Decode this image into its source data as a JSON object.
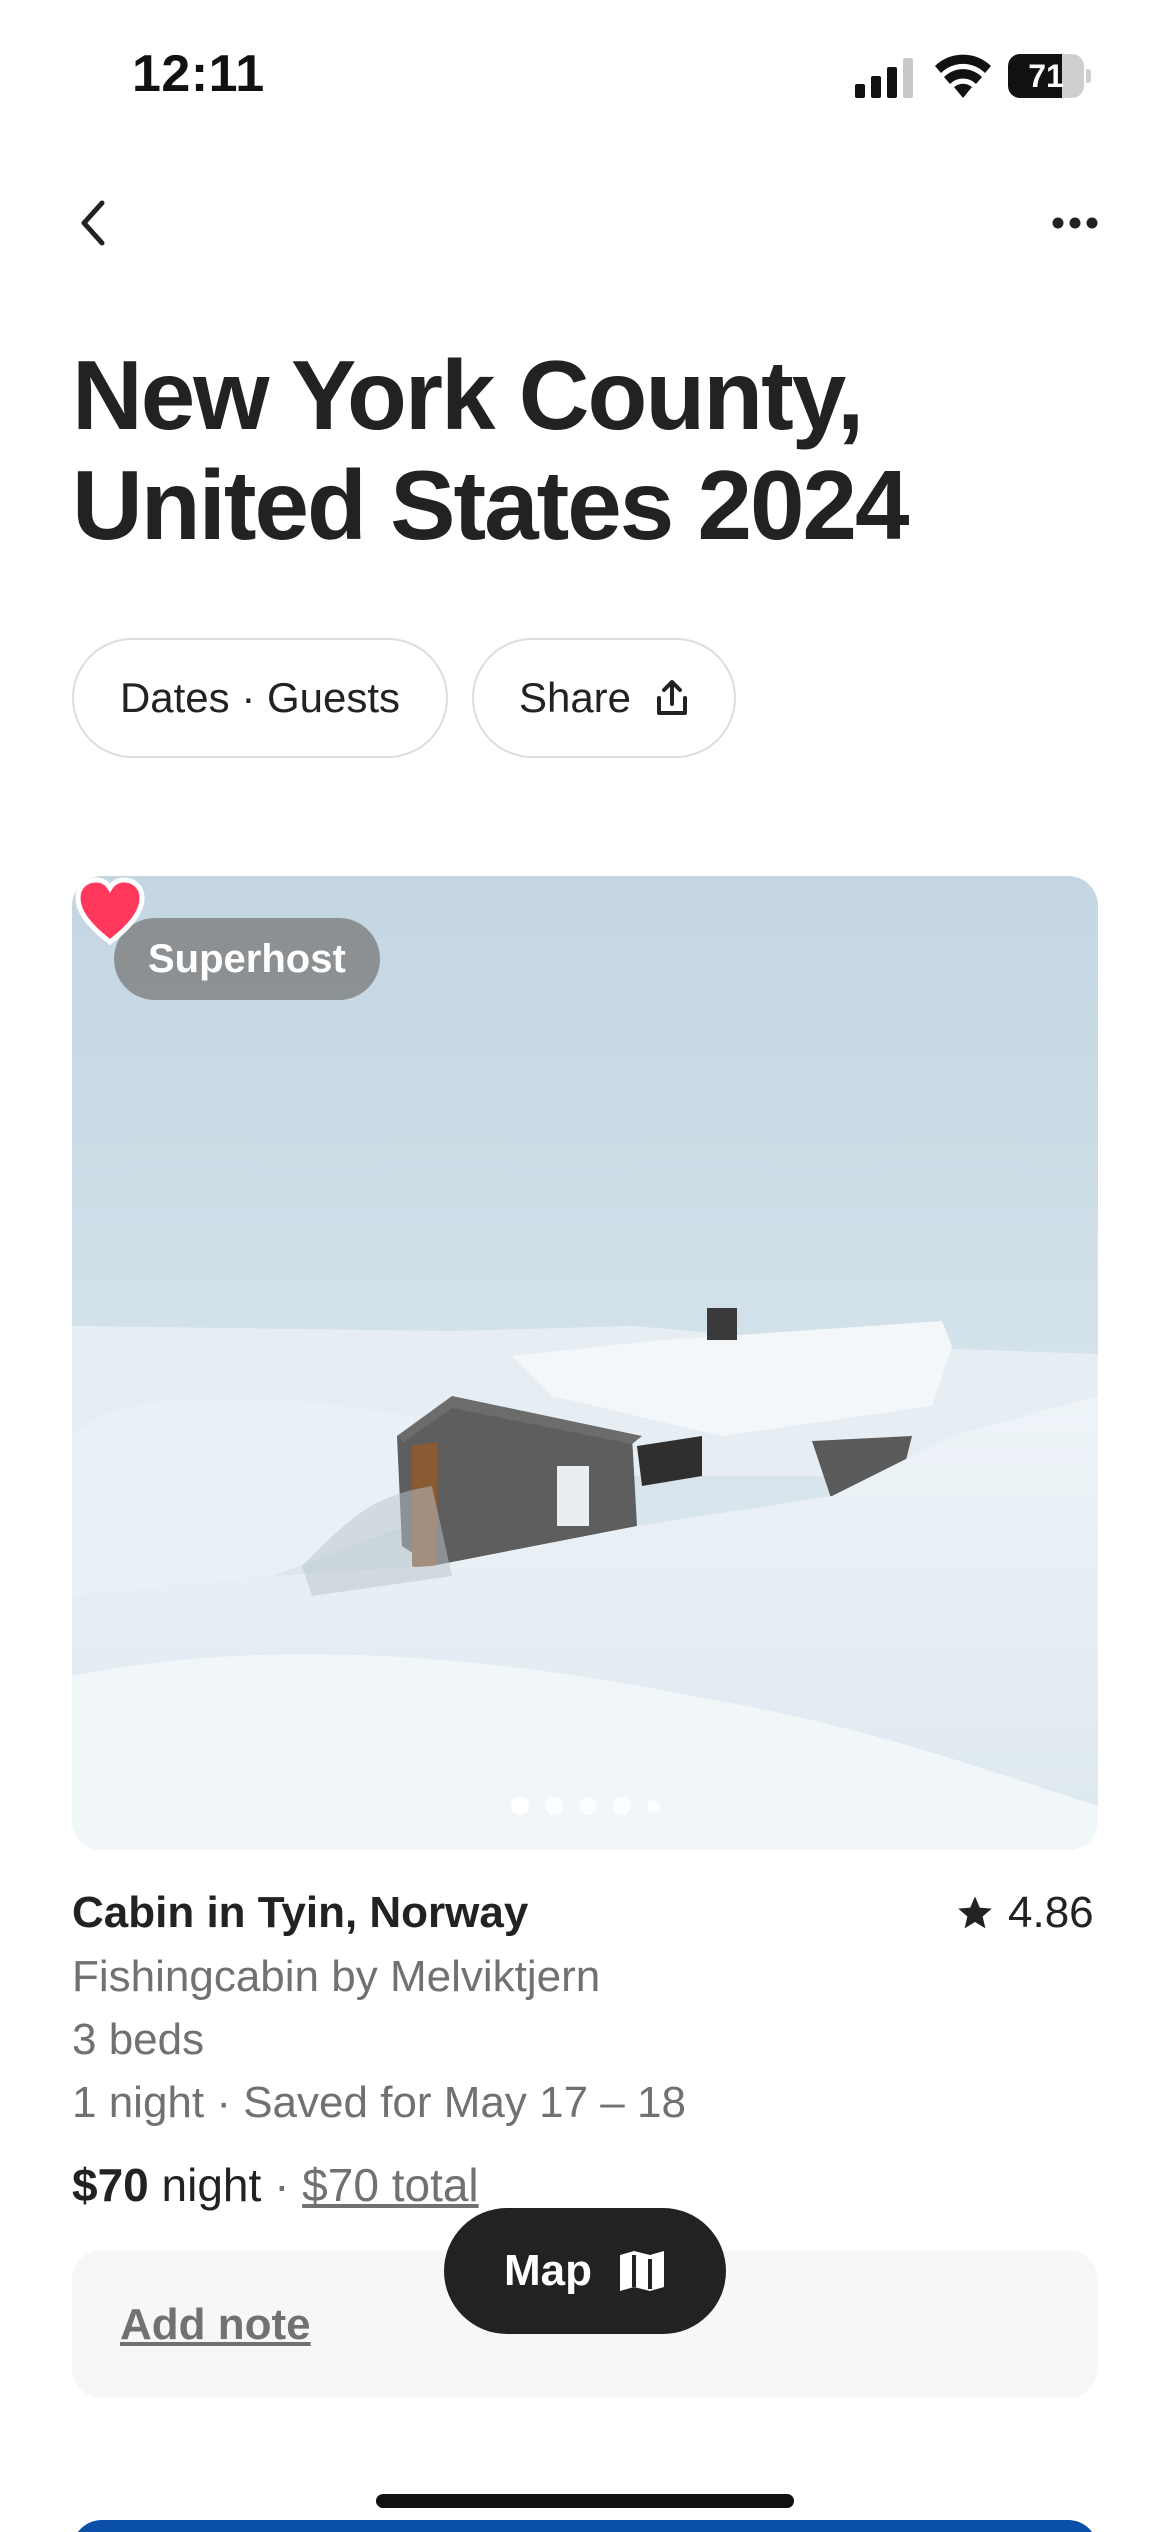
{
  "status_bar": {
    "time": "12:11",
    "battery_level": "71",
    "battery_fraction": 0.71,
    "icons": [
      "signal-icon",
      "wifi-icon",
      "battery-icon"
    ]
  },
  "nav": {
    "back_icon": "chevron-left-icon",
    "more_icon": "more-horizontal-icon"
  },
  "page": {
    "title_line1": "New York County,",
    "title_line2": "United States 2024"
  },
  "actions": {
    "dates_guests_label": "Dates · Guests",
    "share_label": "Share",
    "share_icon": "share-upload-icon"
  },
  "listing": {
    "badge": "Superhost",
    "favorite_icon": "heart-icon",
    "favorite_color": "#ff385c",
    "photo_count": 5,
    "active_photo": 1,
    "title": "Cabin in Tyin, Norway",
    "rating": "4.86",
    "rating_icon": "star-icon",
    "subtitle": "Fishingcabin by Melviktjern",
    "beds": "3 beds",
    "stay": "1 night · Saved for May 17 – 18",
    "price": "$70",
    "price_unit": "night",
    "separator": "·",
    "total": "$70 total"
  },
  "note": {
    "add_note_label": "Add note"
  },
  "map_button": {
    "label": "Map",
    "icon": "map-icon"
  },
  "colors": {
    "text_primary": "#222222",
    "text_secondary": "#717171",
    "accent": "#ff385c",
    "map_button_bg": "#222222"
  }
}
